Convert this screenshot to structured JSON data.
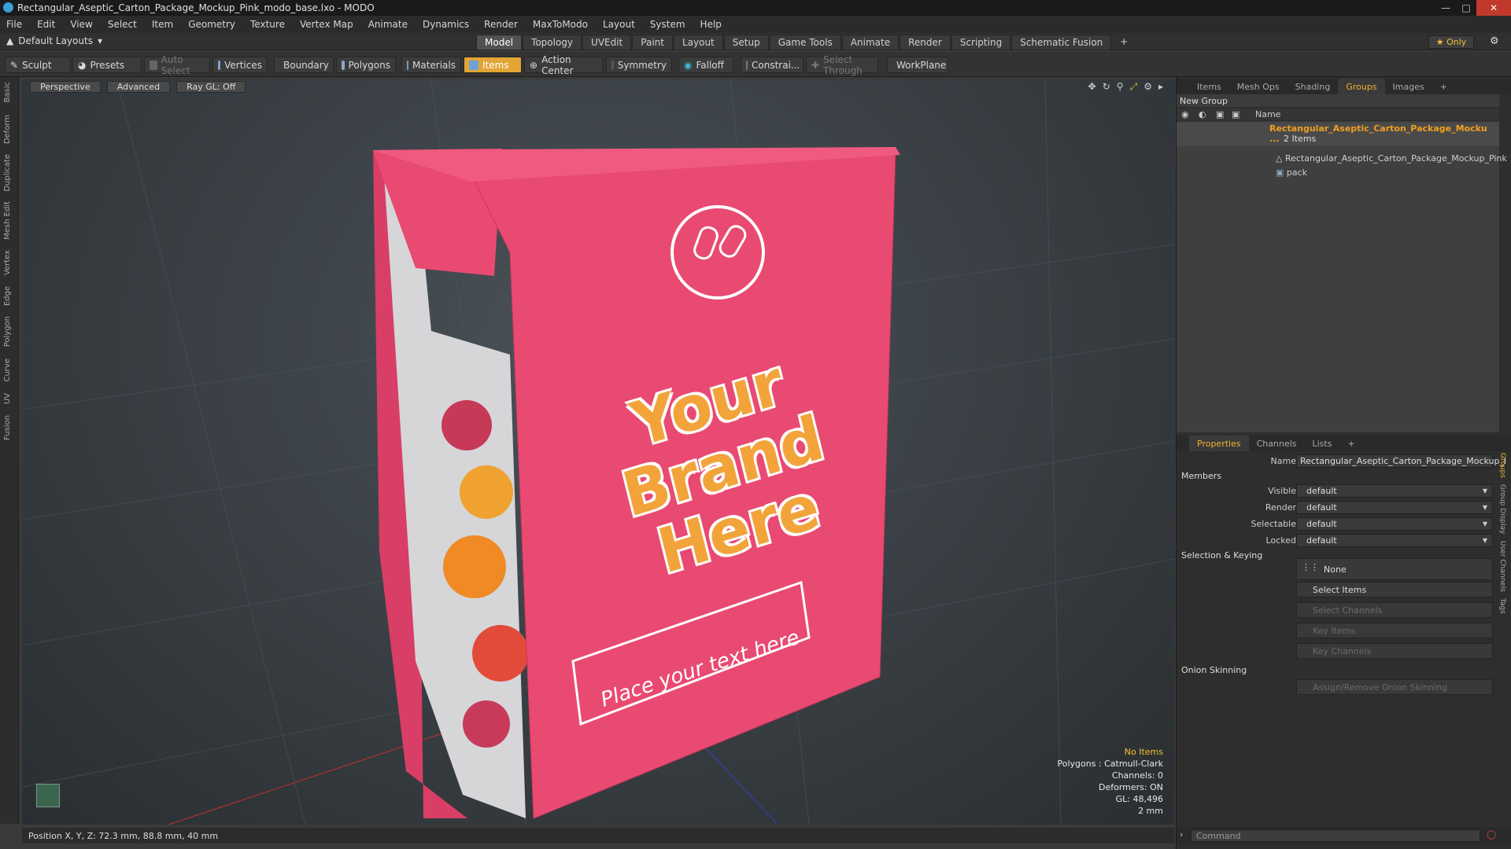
{
  "window": {
    "title": "Rectangular_Aseptic_Carton_Package_Mockup_Pink_modo_base.lxo - MODO"
  },
  "menu": [
    "File",
    "Edit",
    "View",
    "Select",
    "Item",
    "Geometry",
    "Texture",
    "Vertex Map",
    "Animate",
    "Dynamics",
    "Render",
    "MaxToModo",
    "Layout",
    "System",
    "Help"
  ],
  "layout": {
    "selector": "Default Layouts",
    "tabs": [
      "Model",
      "Topology",
      "UVEdit",
      "Paint",
      "Layout",
      "Setup",
      "Game Tools",
      "Animate",
      "Render",
      "Scripting",
      "Schematic Fusion"
    ],
    "active_tab": "Model",
    "only_label": "Only"
  },
  "toolbar": {
    "sculpt": "Sculpt",
    "presets": "Presets",
    "auto_select": "Auto Select",
    "vertices": "Vertices",
    "boundary": "Boundary",
    "polygons": "Polygons",
    "materials": "Materials",
    "items": "Items",
    "action_center": "Action Center",
    "symmetry": "Symmetry",
    "falloff": "Falloff",
    "constraints": "Constrai...",
    "select_through": "Select Through",
    "workplane": "WorkPlane"
  },
  "left_tabs": [
    "Basic",
    "Deform",
    "Duplicate",
    "Mesh Edit",
    "Vertex",
    "Edge",
    "Polygon",
    "Curve",
    "UV",
    "Fusion"
  ],
  "viewport": {
    "view_mode": "Perspective",
    "shading": "Advanced",
    "raygl": "Ray GL: Off",
    "hud": {
      "selection": "No Items",
      "polygons": "Polygons : Catmull-Clark",
      "channels": "Channels: 0",
      "deformers": "Deformers: ON",
      "gl": "GL: 48,496",
      "scale": "2 mm"
    },
    "carton": {
      "brand_line1": "Your",
      "brand_line2": "Brand",
      "brand_line3": "Here",
      "tagline": "Place your text here",
      "color": "#e94a72"
    }
  },
  "status": {
    "position": "Position X, Y, Z:  72.3 mm, 88.8 mm, 40 mm"
  },
  "right_panel": {
    "top_tabs": [
      "Items",
      "Mesh Ops",
      "Shading",
      "Groups",
      "Images"
    ],
    "active_top_tab": "Groups",
    "new_group": "New Group",
    "column_name": "Name",
    "group": {
      "name": "Rectangular_Aseptic_Carton_Package_Mocku ...",
      "count": "2 Items",
      "members": [
        "Rectangular_Aseptic_Carton_Package_Mockup_Pink",
        "pack"
      ]
    },
    "bottom_tabs": [
      "Properties",
      "Channels",
      "Lists"
    ],
    "active_bottom_tab": "Properties",
    "props": {
      "name_label": "Name",
      "name_value": "Rectangular_Aseptic_Carton_Package_Mockup_l",
      "members_section": "Members",
      "visible_label": "Visible",
      "visible_value": "default",
      "render_label": "Render",
      "render_value": "default",
      "selectable_label": "Selectable",
      "selectable_value": "default",
      "locked_label": "Locked",
      "locked_value": "default",
      "selkey_section": "Selection & Keying",
      "none_btn": "None",
      "select_items": "Select Items",
      "select_channels": "Select Channels",
      "key_items": "Key Items",
      "key_channels": "Key Channels",
      "onion_section": "Onion Skinning",
      "onion_btn": "Assign/Remove Onion Skinning"
    },
    "side_tabs": [
      "Groups",
      "Group Display",
      "User Channels",
      "Tags"
    ],
    "command_placeholder": "Command"
  },
  "colors": {
    "accent": "#e2a536",
    "carton": "#e94a72",
    "brand_text": "#f2a43a"
  }
}
